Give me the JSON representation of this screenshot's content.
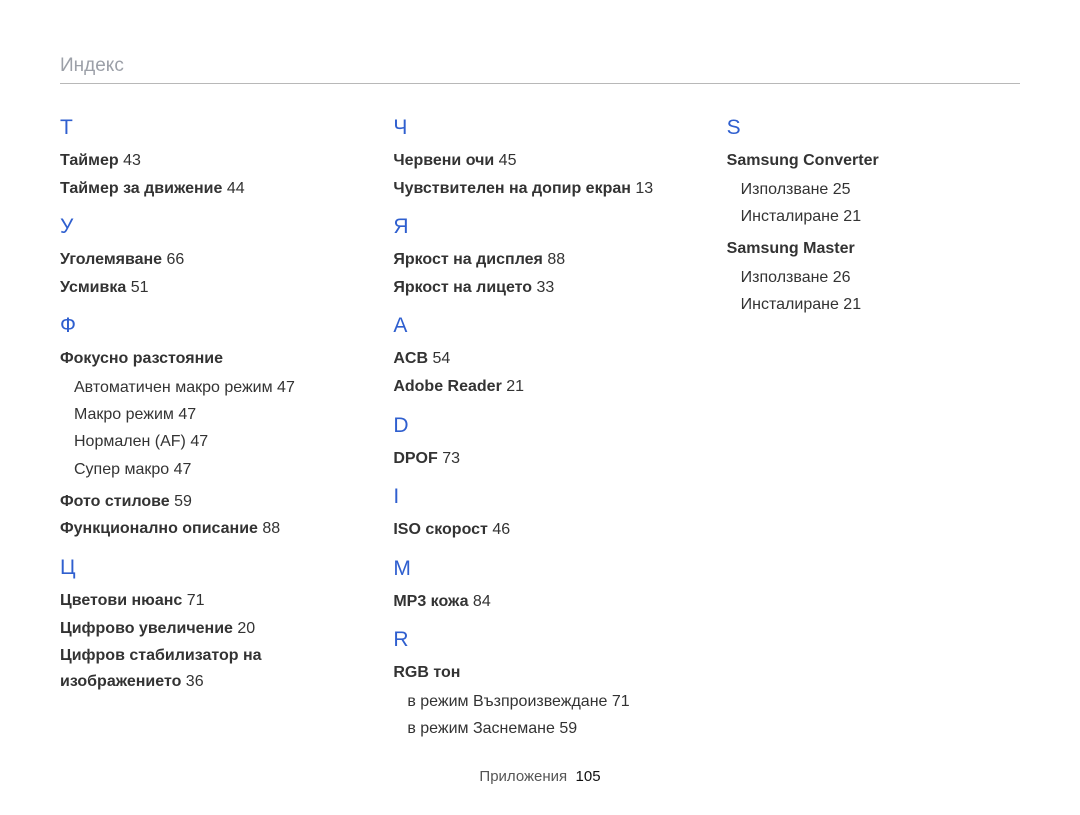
{
  "header": {
    "title": "Индекс"
  },
  "footer": {
    "label": "Приложения",
    "page": "105"
  },
  "cols": [
    {
      "sections": [
        {
          "letter": "Т",
          "entries": [
            {
              "label": "Таймер",
              "page": "43"
            },
            {
              "label": "Таймер за движение",
              "page": "44"
            }
          ]
        },
        {
          "letter": "У",
          "entries": [
            {
              "label": "Уголемяване",
              "page": "66"
            },
            {
              "label": "Усмивка",
              "page": "51"
            }
          ]
        },
        {
          "letter": "Ф",
          "entries": [
            {
              "label": "Фокусно разстояние",
              "page": "",
              "subs": [
                {
                  "label": "Автоматичен макро режим",
                  "page": "47"
                },
                {
                  "label": "Макро режим",
                  "page": "47"
                },
                {
                  "label": "Нормален (AF)",
                  "page": "47"
                },
                {
                  "label": "Супер макро",
                  "page": "47"
                }
              ]
            },
            {
              "label": "Фото стилове",
              "page": "59"
            },
            {
              "label": "Функционално описание",
              "page": "88"
            }
          ]
        },
        {
          "letter": "Ц",
          "entries": [
            {
              "label": "Цветови нюанс",
              "page": "71"
            },
            {
              "label": "Цифрово увеличение",
              "page": "20"
            },
            {
              "label": "Цифров стабилизатор на изображението",
              "page": "36"
            }
          ]
        }
      ]
    },
    {
      "sections": [
        {
          "letter": "Ч",
          "entries": [
            {
              "label": "Червени очи",
              "page": "45"
            },
            {
              "label": "Чувствителен на допир екран",
              "page": "13"
            }
          ]
        },
        {
          "letter": "Я",
          "entries": [
            {
              "label": "Яркост на дисплея",
              "page": "88"
            },
            {
              "label": "Яркост на лицето",
              "page": "33"
            }
          ]
        },
        {
          "letter": "A",
          "entries": [
            {
              "label": "ACB",
              "page": "54"
            },
            {
              "label": "Adobe Reader",
              "page": "21"
            }
          ]
        },
        {
          "letter": "D",
          "entries": [
            {
              "label": "DPOF",
              "page": "73"
            }
          ]
        },
        {
          "letter": "I",
          "entries": [
            {
              "label": "ISO скорост",
              "page": "46"
            }
          ]
        },
        {
          "letter": "M",
          "entries": [
            {
              "label": "MP3 кожа",
              "page": "84"
            }
          ]
        },
        {
          "letter": "R",
          "entries": [
            {
              "label": "RGB тон",
              "page": "",
              "subs": [
                {
                  "label": "в режим Възпроизвеждане",
                  "page": "71"
                },
                {
                  "label": "в режим Заснемане",
                  "page": "59"
                }
              ]
            }
          ]
        }
      ]
    },
    {
      "sections": [
        {
          "letter": "S",
          "entries": [
            {
              "label": "Samsung Converter",
              "page": "",
              "subs": [
                {
                  "label": "Използване",
                  "page": "25"
                },
                {
                  "label": "Инсталиране",
                  "page": "21"
                }
              ]
            },
            {
              "label": "Samsung Master",
              "page": "",
              "subs": [
                {
                  "label": "Използване",
                  "page": "26"
                },
                {
                  "label": "Инсталиране",
                  "page": "21"
                }
              ]
            }
          ]
        }
      ]
    }
  ]
}
